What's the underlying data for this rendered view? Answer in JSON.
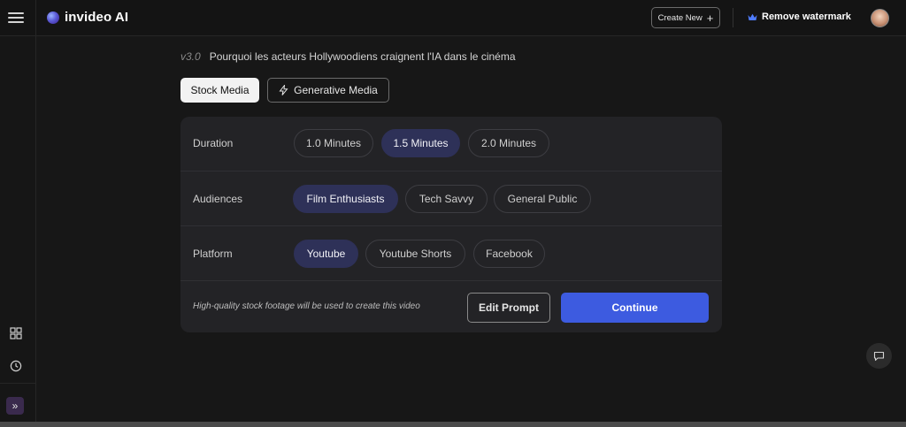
{
  "app": {
    "name": "invideo AI"
  },
  "header": {
    "create_new_label": "Create New",
    "remove_watermark_label": "Remove watermark"
  },
  "prompt": {
    "version": "v3.0",
    "title": "Pourquoi les acteurs Hollywoodiens craignent l'IA dans le cinéma"
  },
  "media_tabs": {
    "stock_label": "Stock Media",
    "generative_label": "Generative Media"
  },
  "settings": {
    "duration": {
      "label": "Duration",
      "options": [
        "1.0 Minutes",
        "1.5 Minutes",
        "2.0 Minutes"
      ],
      "selected": "1.5 Minutes"
    },
    "audiences": {
      "label": "Audiences",
      "options": [
        "Film Enthusiasts",
        "Tech Savvy",
        "General Public"
      ],
      "selected": "Film Enthusiasts"
    },
    "platform": {
      "label": "Platform",
      "options": [
        "Youtube",
        "Youtube Shorts",
        "Facebook"
      ],
      "selected": "Youtube"
    }
  },
  "footer": {
    "note": "High-quality stock footage will be used to create this video",
    "edit_prompt_label": "Edit Prompt",
    "continue_label": "Continue"
  },
  "colors": {
    "accent": "#3d5be0",
    "chip_selected": "#2e3158",
    "panel_bg": "#232326",
    "page_bg": "#171717"
  },
  "icons": {
    "menu": "hamburger-icon",
    "crown": "crown-icon",
    "bolt": "bolt-icon",
    "grid": "grid-icon",
    "history": "clock-icon",
    "expand": "double-chevron-right-icon",
    "chat": "chat-icon"
  }
}
